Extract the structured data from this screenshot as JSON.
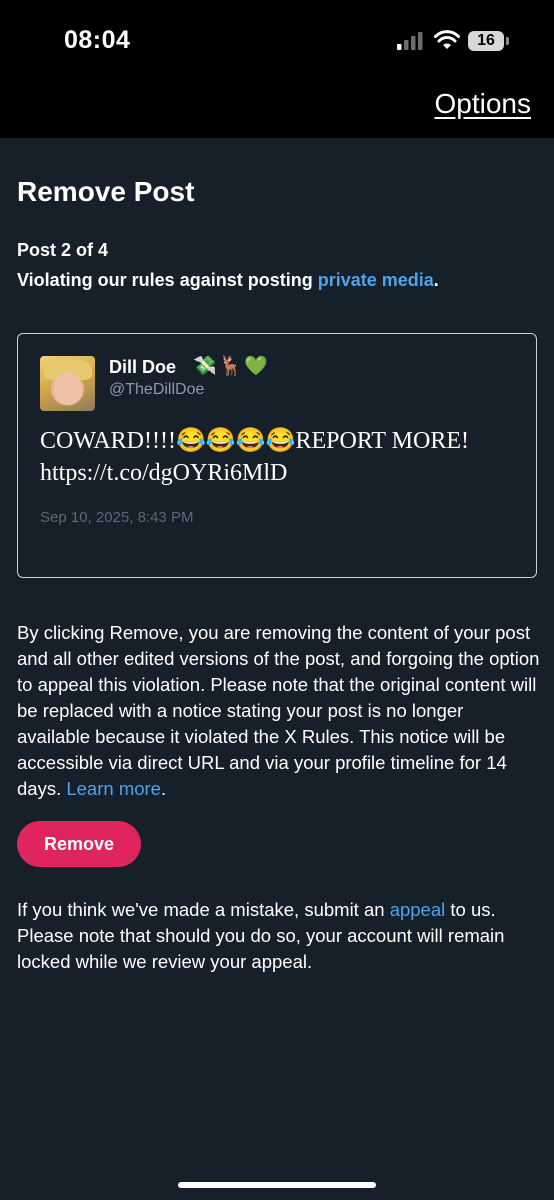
{
  "status_bar": {
    "time": "08:04",
    "battery": "16"
  },
  "topbar": {
    "options_label": "Options"
  },
  "page": {
    "title": "Remove Post",
    "post_count": "Post 2 of 4",
    "violation_prefix": "Violating our rules against posting ",
    "violation_link": "private media",
    "violation_suffix": "."
  },
  "tweet": {
    "display_name": "Dill Doe",
    "name_emojis": "💸🦌💚",
    "handle": "@TheDillDoe",
    "text_line1": "COWARD!!!!😂😂😂😂REPORT MORE!",
    "text_line2": "https://t.co/dgOYRi6MlD",
    "date": "Sep 10, 2025, 8:43 PM"
  },
  "notice": {
    "body": "By clicking Remove, you are removing the content of your post and all other edited versions of the post, and forgoing the option to appeal this violation. Please note that the original content will be replaced with a notice stating your post is no longer available because it violated the X Rules. This notice will be accessible via direct URL and via your profile timeline for 14 days. ",
    "learn_more": "Learn more",
    "body_end": "."
  },
  "actions": {
    "remove_label": "Remove"
  },
  "appeal": {
    "prefix": "If you think we've made a mistake, submit an ",
    "link": "appeal",
    "suffix": " to us. Please note that should you do so, your account will remain locked while we review your appeal."
  },
  "colors": {
    "background": "#15202b",
    "link": "#4ea3ea",
    "remove_button": "#e0245e"
  }
}
